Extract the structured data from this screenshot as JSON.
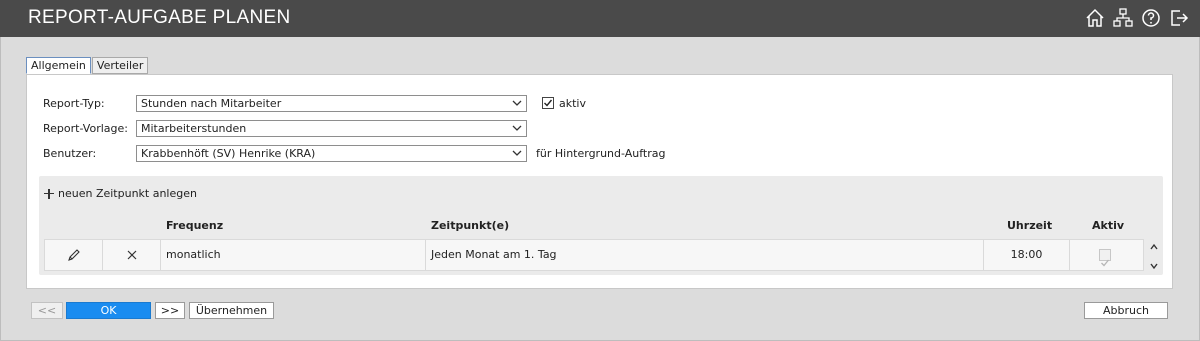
{
  "header": {
    "title": "REPORT-AUFGABE PLANEN",
    "icons": [
      "home-icon",
      "hierarchy-icon",
      "help-icon",
      "logout-icon"
    ]
  },
  "tabs": [
    {
      "label": "Allgemein",
      "active": true
    },
    {
      "label": "Verteiler",
      "active": false
    }
  ],
  "form": {
    "report_type": {
      "label": "Report-Typ:",
      "value": "Stunden nach Mitarbeiter"
    },
    "active": {
      "label": "aktiv",
      "checked": true
    },
    "report_template": {
      "label": "Report-Vorlage:",
      "value": "Mitarbeiterstunden"
    },
    "user": {
      "label": "Benutzer:",
      "value": "Krabbenhöft (SV) Henrike (KRA)",
      "hint": "für Hintergrund-Auftrag"
    }
  },
  "schedule": {
    "add_label": "neuen Zeitpunkt anlegen",
    "columns": [
      "Frequenz",
      "Zeitpunkt(e)",
      "Uhrzeit",
      "Aktiv"
    ],
    "rows": [
      {
        "frequency": "monatlich",
        "times": "Jeden Monat am 1. Tag",
        "time": "18:00",
        "active": true
      }
    ]
  },
  "footer": {
    "prev_label": "<<",
    "ok_label": "OK",
    "next_label": ">>",
    "apply_label": "Übernehmen",
    "cancel_label": "Abbruch"
  },
  "colors": {
    "titlebar": "#4a4a4a",
    "primary": "#1a8cf0"
  }
}
